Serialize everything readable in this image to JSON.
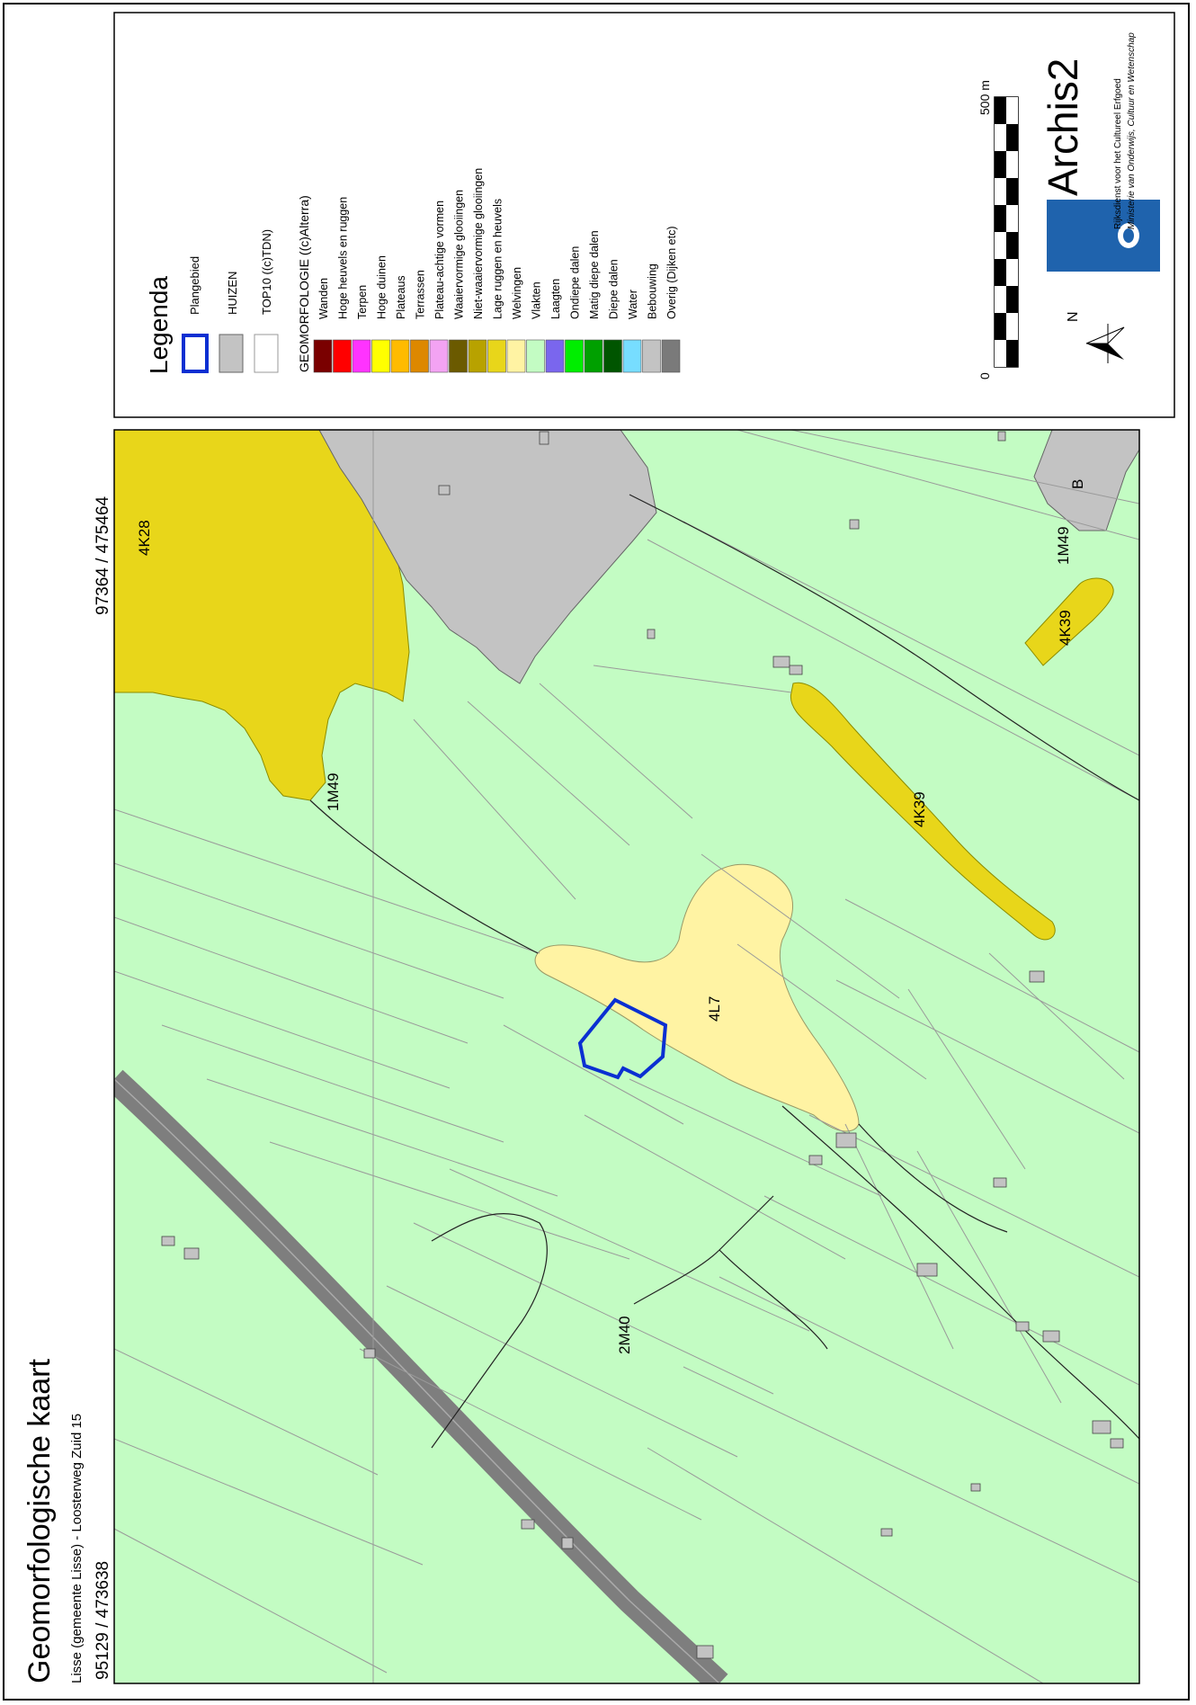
{
  "title": "Geomorfologische kaart",
  "subtitle": "Lisse (gemeente Lisse) - Loosterweg Zuid 15",
  "coord_top": "97364 / 475464",
  "coord_bottom": "95129 / 473638",
  "map_labels": {
    "l_4K28": "4K28",
    "l_1M49_a": "1M49",
    "l_1M49_b": "1M49",
    "l_4K39_a": "4K39",
    "l_4K39_b": "4K39",
    "l_4L7": "4L7",
    "l_2M40": "2M40",
    "l_B": "B"
  },
  "legend": {
    "title": "Legenda",
    "plangebied": "Plangebied",
    "huizen": "HUIZEN",
    "top10": "TOP10 ((c)TDN)",
    "geomorfologie": "GEOMORFOLOGIE ((c)Alterra)",
    "items": [
      {
        "label": "Wanden",
        "color": "#7a0000"
      },
      {
        "label": "Hoge heuvels en ruggen",
        "color": "#ff0000"
      },
      {
        "label": "Terpen",
        "color": "#ff33ff"
      },
      {
        "label": "Hoge duinen",
        "color": "#ffff00"
      },
      {
        "label": "Plateaus",
        "color": "#ffbb00"
      },
      {
        "label": "Terrassen",
        "color": "#dd8800"
      },
      {
        "label": "Plateau-achtige vormen",
        "color": "#f3a3f3"
      },
      {
        "label": "Waaiervormige glooiingen",
        "color": "#6b5a00"
      },
      {
        "label": "Niet-waaiervormige glooiingen",
        "color": "#b8a200"
      },
      {
        "label": "Lage ruggen en heuvels",
        "color": "#e8d61a"
      },
      {
        "label": "Welvingen",
        "color": "#fff3a3"
      },
      {
        "label": "Vlakten",
        "color": "#c3fcc3"
      },
      {
        "label": "Laagten",
        "color": "#7a66ee"
      },
      {
        "label": "Ondiepe dalen",
        "color": "#00ee00"
      },
      {
        "label": "Matig diepe dalen",
        "color": "#00a000"
      },
      {
        "label": "Diepe dalen",
        "color": "#005500"
      },
      {
        "label": "Water",
        "color": "#77ddff"
      },
      {
        "label": "Bebouwing",
        "color": "#c3c3c3"
      },
      {
        "label": "Overig (Dijken etc)",
        "color": "#7a7a7a"
      }
    ]
  },
  "scale": {
    "zero": "0",
    "max": "500 m"
  },
  "north": "N",
  "archis": {
    "name": "Archis2",
    "org1": "Rijksdienst voor het Cultureel Erfgoed",
    "org2": "Ministerie van Onderwijs, Cultuur en Wetenschap"
  },
  "colors": {
    "vlakten": "#c3fcc3",
    "lage_ruggen": "#e8d61a",
    "welvingen": "#fff3a3",
    "bebouwing": "#c3c3c3",
    "road": "#808080",
    "plangebied": "#0a2fd2",
    "logo_blue": "#1f63ad"
  }
}
